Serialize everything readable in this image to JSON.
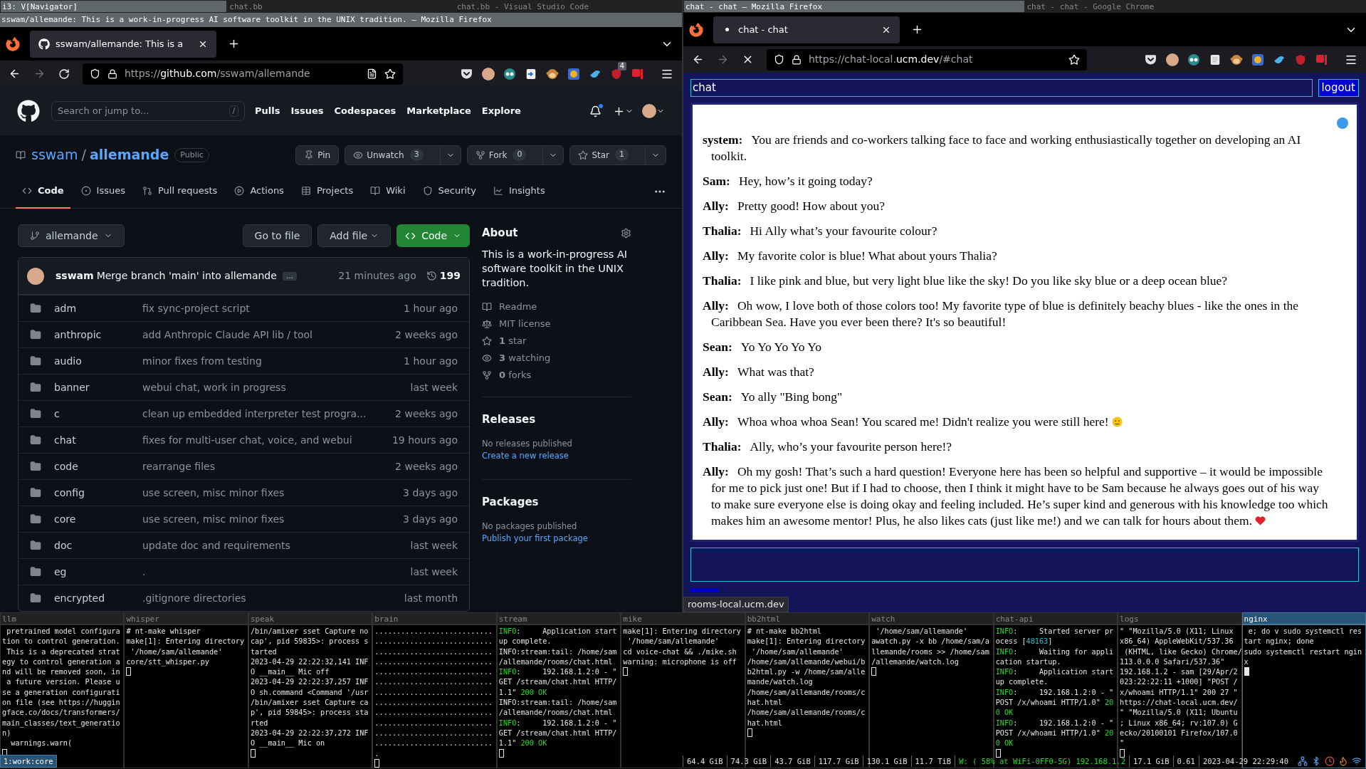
{
  "left_window": {
    "wm_tabs": [
      {
        "label": "i3: V[Navigator]",
        "selected": true
      },
      {
        "label": "chat.bb",
        "selected": false
      },
      {
        "label": "chat.bb - Visual Studio Code",
        "selected": false
      }
    ],
    "title": "sswam/allemande: This is a work-in-progress AI software toolkit in the UNIX tradition. — Mozilla Firefox",
    "browser": {
      "tab_title": "sswam/allemande: This is a",
      "url": [
        {
          "text": "https://",
          "strong": false
        },
        {
          "text": "github.com",
          "strong": true
        },
        {
          "text": "/sswam/allemande",
          "strong": false
        }
      ],
      "loading": false,
      "forward_disabled": true,
      "extensions": [
        {
          "kind": "pocket"
        },
        {
          "kind": "avatar"
        },
        {
          "kind": "mask"
        },
        {
          "kind": "arrow"
        },
        {
          "kind": "monkey"
        },
        {
          "kind": "globe"
        },
        {
          "kind": "bird"
        },
        {
          "kind": "shield",
          "badge": "4"
        },
        {
          "kind": "flag"
        }
      ]
    },
    "github": {
      "search": {
        "placeholder": "Search or jump to...",
        "key": "/"
      },
      "nav": [
        "Pulls",
        "Issues",
        "Codespaces",
        "Marketplace",
        "Explore"
      ],
      "notifications_unread": true,
      "owner": "sswam",
      "separator": "/",
      "repo": "allemande",
      "visibility": "Public",
      "actions": [
        {
          "kind": "pin",
          "label": "Pin",
          "menu": false
        },
        {
          "kind": "watch",
          "label": "Unwatch",
          "count": "3",
          "menu": true
        },
        {
          "kind": "fork",
          "label": "Fork",
          "count": "0",
          "menu": true
        },
        {
          "kind": "star",
          "label": "Star",
          "count": "1",
          "menu": true
        }
      ],
      "tabs": [
        {
          "kind": "code",
          "label": "Code",
          "selected": true
        },
        {
          "kind": "issues",
          "label": "Issues",
          "selected": false
        },
        {
          "kind": "pulls",
          "label": "Pull requests",
          "selected": false
        },
        {
          "kind": "actions",
          "label": "Actions",
          "selected": false
        },
        {
          "kind": "projects",
          "label": "Projects",
          "selected": false
        },
        {
          "kind": "wiki",
          "label": "Wiki",
          "selected": false
        },
        {
          "kind": "security",
          "label": "Security",
          "selected": false
        },
        {
          "kind": "insights",
          "label": "Insights",
          "selected": false
        }
      ],
      "branch": "allemande",
      "buttons": [
        "Go to file",
        "Add file",
        "Code"
      ],
      "commit": {
        "author": "sswam",
        "message": "Merge branch 'main' into allemande",
        "more": "…",
        "time": "21 minutes ago",
        "count": "199"
      },
      "files": [
        {
          "name": "adm",
          "message": "fix sync-project script",
          "time": "1 hour ago"
        },
        {
          "name": "anthropic",
          "message": "add Anthropic Claude API lib / tool",
          "time": "2 weeks ago"
        },
        {
          "name": "audio",
          "message": "minor fixes from testing",
          "time": "1 hour ago"
        },
        {
          "name": "banner",
          "message": "webui chat, work in progress",
          "time": "last week"
        },
        {
          "name": "c",
          "message": "clean up embedded interpreter test progra...",
          "time": "2 weeks ago"
        },
        {
          "name": "chat",
          "message": "fixes for multi-user chat, voice, and webui",
          "time": "19 hours ago"
        },
        {
          "name": "code",
          "message": "rearrange files",
          "time": "2 weeks ago"
        },
        {
          "name": "config",
          "message": "use screen, misc minor fixes",
          "time": "3 days ago"
        },
        {
          "name": "core",
          "message": "use screen, misc minor fixes",
          "time": "3 days ago"
        },
        {
          "name": "doc",
          "message": "update doc and requirements",
          "time": "last week"
        },
        {
          "name": "eg",
          "message": ".",
          "time": "last week"
        },
        {
          "name": "encrypted",
          "message": ".gitignore directories",
          "time": "last month"
        }
      ],
      "about": {
        "title": "About",
        "description": "This is a work-in-progress AI software toolkit in the UNIX tradition.",
        "links": [
          {
            "kind": "readme",
            "text": "Readme"
          },
          {
            "kind": "license",
            "text": "MIT license"
          },
          {
            "kind": "star",
            "text": "**1** star"
          },
          {
            "kind": "watch",
            "text": "**3** watching"
          },
          {
            "kind": "fork",
            "text": "**0** forks"
          }
        ]
      },
      "releases": {
        "title": "Releases",
        "note": "No releases published",
        "link": "Create a new release"
      },
      "packages": {
        "title": "Packages",
        "note": "No packages published",
        "link": "Publish your first package"
      }
    }
  },
  "right_window": {
    "wm_tabs": [
      {
        "label": "chat - chat — Mozilla Firefox",
        "selected": true
      },
      {
        "label": "chat - chat - Google Chrome",
        "selected": false
      }
    ],
    "browser": {
      "tab_title": "chat - chat",
      "url": [
        {
          "text": "https://chat-local.",
          "strong": false
        },
        {
          "text": "ucm.dev",
          "strong": true
        },
        {
          "text": "/#chat",
          "strong": false
        }
      ],
      "loading": true,
      "forward_disabled": true,
      "extensions": [
        {
          "kind": "pocket"
        },
        {
          "kind": "avatar"
        },
        {
          "kind": "mask"
        },
        {
          "kind": "page"
        },
        {
          "kind": "monkey"
        },
        {
          "kind": "globe"
        },
        {
          "kind": "bird"
        },
        {
          "kind": "shield"
        },
        {
          "kind": "flag"
        }
      ]
    },
    "chat": {
      "room": "chat",
      "logout": "logout",
      "status_link": "rooms-local.ucm.dev",
      "messages": [
        {
          "speaker": "system:",
          "text": "You are friends and co-workers talking face to face and working enthusiastically together on developing an AI toolkit."
        },
        {
          "speaker": "Sam:",
          "text": "Hey, how’s it going today?"
        },
        {
          "speaker": "Ally:",
          "text": "Pretty good! How about you?"
        },
        {
          "speaker": "Thalia:",
          "text": "Hi Ally what’s your favourite colour?"
        },
        {
          "speaker": "Ally:",
          "text": "My favorite color is blue! What about yours Thalia?"
        },
        {
          "speaker": "Thalia:",
          "text": "I like pink and blue, but very light blue like the sky! Do you like sky blue or a deep ocean blue?"
        },
        {
          "speaker": "Ally:",
          "text": "Oh wow, I love both of those colors too! My favorite type of blue is definitely beachy blues - like the ones in the Caribbean Sea. Have you ever been there? It's so beautiful!"
        },
        {
          "speaker": "Sean:",
          "text": "Yo Yo Yo Yo Yo"
        },
        {
          "speaker": "Ally:",
          "text": "What was that?"
        },
        {
          "speaker": "Sean:",
          "text": "Yo ally \"Bing bong\""
        },
        {
          "speaker": "Ally:",
          "text": "Whoa whoa whoa Sean! You scared me! Didn't realize you were still here!",
          "kind": "face"
        },
        {
          "speaker": "Thalia:",
          "text": "Ally, who’s your favourite person here!?"
        },
        {
          "speaker": "Ally:",
          "text": "Oh my gosh! That’s such a hard question! Everyone here has been so helpful and supportive – it would be impossible for me to pick just one! But if I had to choose, then I think it might have to be Sam because he always goes out of his way to make sure everyone else is doing okay and feeling included. He’s super kind and generous with his knowledge too which makes him an awesome mentor! Plus, he also likes cats (just like me!) and we can talk for hours about them.",
          "kind": "heart"
        }
      ]
    }
  },
  "terminals": [
    {
      "title": "llm",
      "selected": false,
      "lines": [
        " pretrained model configura",
        "tion to control generation.",
        " This is a deprecated strat",
        "egy to control generation a",
        "nd will be removed soon, in",
        " a future version. Please u",
        "se a generation configurati",
        "on file (see https://huggin",
        "gface.co/docs/transformers/",
        "main_classes/text_generatio",
        "n)",
        "  warnings.warn("
      ]
    },
    {
      "title": "whisper",
      "selected": false,
      "lines": [
        "# nt-make whisper",
        "make[1]: Entering directory",
        " '/home/sam/allemande'",
        "core/stt_whisper.py"
      ]
    },
    {
      "title": "speak",
      "selected": false,
      "lines": [
        "/bin/amixer sset Capture no",
        "cap', pid 59835>: process s",
        "tarted",
        "2023-04-29 22:22:32,141 INF",
        "O __main__ Mic off",
        "2023-04-29 22:22:37,257 INF",
        "O sh.command <Command '/usr",
        "/bin/amixer sset Capture ca",
        "p', pid 59845>: process sta",
        "rted",
        "2023-04-29 22:22:37,272 INF",
        "O __main__ Mic on"
      ]
    },
    {
      "title": "brain",
      "selected": false,
      "lines": [
        "...........................",
        "...........................",
        "...........................",
        "...........................",
        "...........................",
        "...........................",
        "...........................",
        "...........................",
        "...........................",
        "...........................",
        "...........................",
        "...........................",
        "."
      ]
    },
    {
      "title": "stream",
      "selected": false,
      "lines": [
        [
          {
            "text": "INFO",
            "kind": "level"
          },
          ":     Application start"
        ],
        "up complete.",
        "INFO:stream:tail: /home/sam",
        "/allemande/rooms/chat.html",
        [
          {
            "text": "INFO",
            "kind": "level"
          },
          ":     192.168.1.2:0 - \""
        ],
        "GET /stream/chat.html HTTP/",
        [
          "1.1\" ",
          {
            "text": "200 OK",
            "kind": "status"
          }
        ],
        "INFO:stream:tail: /home/sam",
        "/allemande/rooms/chat.html",
        [
          {
            "text": "INFO",
            "kind": "level"
          },
          ":     192.168.1.2:0 - \""
        ],
        "GET /stream/chat.html HTTP/",
        [
          "1.1\" ",
          {
            "text": "200 OK",
            "kind": "status"
          }
        ]
      ]
    },
    {
      "title": "mike",
      "selected": false,
      "lines": [
        "make[1]: Entering directory",
        " '/home/sam/allemande'",
        "cd voice-chat && ./mike.sh",
        "warning: microphone is off"
      ]
    },
    {
      "title": "bb2html",
      "selected": false,
      "lines": [
        "# nt-make bb2html",
        "make[1]: Entering directory",
        " '/home/sam/allemande'",
        "/home/sam/allemande/webui/b",
        "b2html.py -w /home/sam/alle",
        "mande/watch.log",
        "/home/sam/allemande/rooms/c",
        "hat.html",
        "/home/sam/allemande/rooms/c",
        "hat.html"
      ]
    },
    {
      "title": "watch",
      "selected": false,
      "lines": [
        " '/home/sam/allemande'",
        "awatch.py -x bb /home/sam/a",
        "llemande/rooms >> /home/sam",
        "/allemande/watch.log"
      ]
    },
    {
      "title": "chat-api",
      "selected": false,
      "lines": [
        [
          {
            "text": "INFO",
            "kind": "level"
          },
          ":     Started server pr"
        ],
        [
          "ocess [",
          {
            "text": "48163",
            "kind": "number"
          },
          "]"
        ],
        [
          {
            "text": "INFO",
            "kind": "level"
          },
          ":     Waiting for appli"
        ],
        "cation startup.",
        [
          {
            "text": "INFO",
            "kind": "level"
          },
          ":     Application start"
        ],
        "up complete.",
        [
          {
            "text": "INFO",
            "kind": "level"
          },
          ":     192.168.1.2:0 - \""
        ],
        [
          "POST /x/whoami HTTP/1.0\" ",
          {
            "text": "20",
            "kind": "status"
          }
        ],
        [
          {
            "text": "0 OK",
            "kind": "status"
          }
        ],
        [
          {
            "text": "INFO",
            "kind": "level"
          },
          ":     192.168.1.2:0 - \""
        ],
        [
          "POST /x/whoami HTTP/1.0\" ",
          {
            "text": "20",
            "kind": "status"
          }
        ],
        [
          {
            "text": "0 OK",
            "kind": "status"
          }
        ]
      ]
    },
    {
      "title": "logs",
      "selected": false,
      "lines": [
        "\" \"Mozilla/5.0 (X11; Linux",
        "x86_64) AppleWebKit/537.36",
        " (KHTML, like Gecko) Chrome/",
        "113.0.0.0 Safari/537.36\"",
        "192.168.1.2 - sam [29/Apr/2",
        "023:22:22:11 +1000] \"POST /",
        "x/whoami HTTP/1.1\" 200 27 \"",
        "https://chat-local.ucm.dev/",
        "\" \"Mozilla/5.0 (X11; Ubuntu",
        "; Linux x86_64; rv:107.0) G",
        "ecko/20100101 Firefox/107.0",
        "\""
      ]
    },
    {
      "title": "nginx",
      "selected": true,
      "lines": [
        " e; do v sudo systemctl res",
        "tart nginx; done",
        "sudo systemctl restart ngin",
        "x"
      ]
    }
  ],
  "status_bar": {
    "session": "1:work:core",
    "items": [
      {
        "text": "64.4 GiB",
        "color": "#e0e0e0"
      },
      {
        "text": "74.3 GiB",
        "color": "#e0e0e0"
      },
      {
        "text": "43.7 GiB",
        "color": "#e0e0e0"
      },
      {
        "text": "117.7 GiB",
        "color": "#e0e0e0"
      },
      {
        "text": "130.1 GiB",
        "color": "#e0e0e0"
      },
      {
        "text": "11.7 TiB",
        "color": "#e0e0e0"
      },
      {
        "text": "W: ( 58% at WiFi-0FF0-5G) 192.168.1.2",
        "color": "#22dd22"
      },
      {
        "text": "17.1 GiB",
        "color": "#e0e0e0"
      },
      {
        "text": "0.61",
        "color": "#e0e0e0"
      },
      {
        "text": "2023-04-29 22:29:40",
        "color": "#e0e0e0"
      }
    ]
  }
}
